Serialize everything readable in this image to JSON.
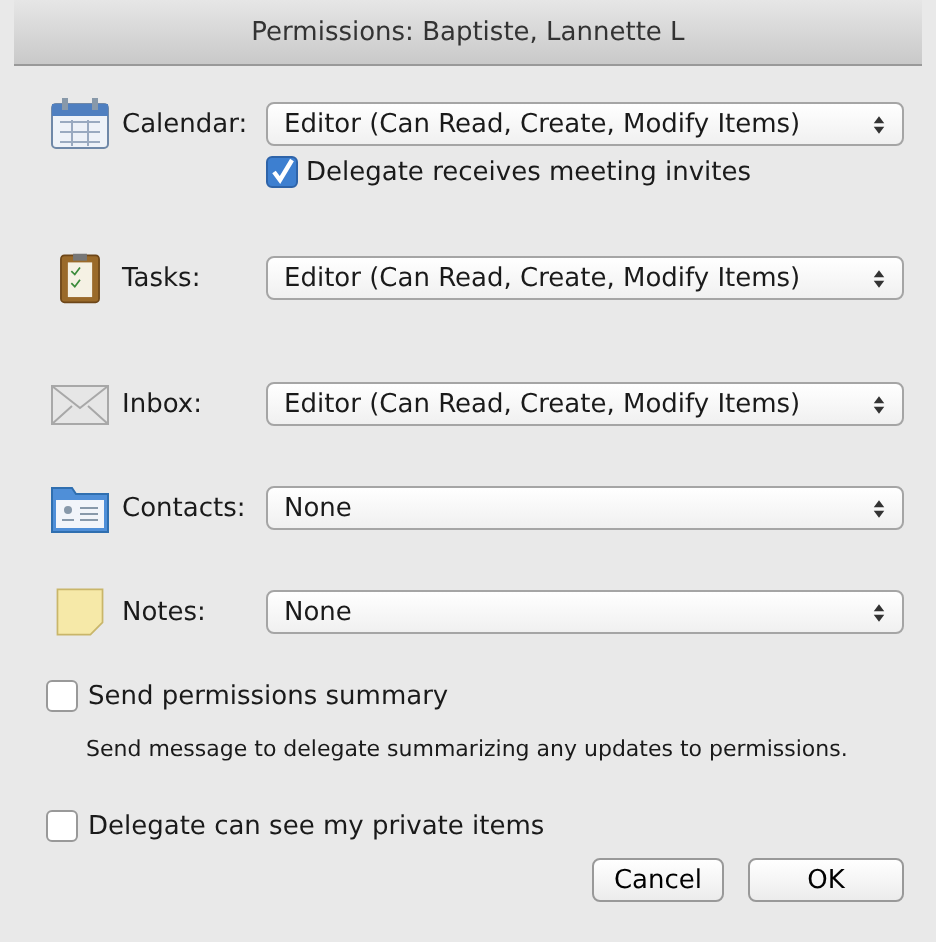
{
  "window": {
    "title": "Permissions: Baptiste, Lannette L"
  },
  "folders": [
    {
      "kind": "calendar",
      "label": "Calendar:",
      "value": "Editor (Can Read, Create, Modify Items)",
      "option": {
        "label": "Delegate receives meeting invites",
        "checked": true
      }
    },
    {
      "kind": "tasks",
      "label": "Tasks:",
      "value": "Editor (Can Read, Create, Modify Items)"
    },
    {
      "kind": "inbox",
      "label": "Inbox:",
      "value": "Editor (Can Read, Create, Modify Items)"
    },
    {
      "kind": "contacts",
      "label": "Contacts:",
      "value": "None"
    },
    {
      "kind": "notes",
      "label": "Notes:",
      "value": "None"
    }
  ],
  "summary": {
    "label": "Send permissions summary",
    "checked": false,
    "description": "Send message to delegate summarizing any updates to permissions."
  },
  "private_items": {
    "label": "Delegate can see my private items",
    "checked": false
  },
  "buttons": [
    "Cancel",
    "OK"
  ]
}
